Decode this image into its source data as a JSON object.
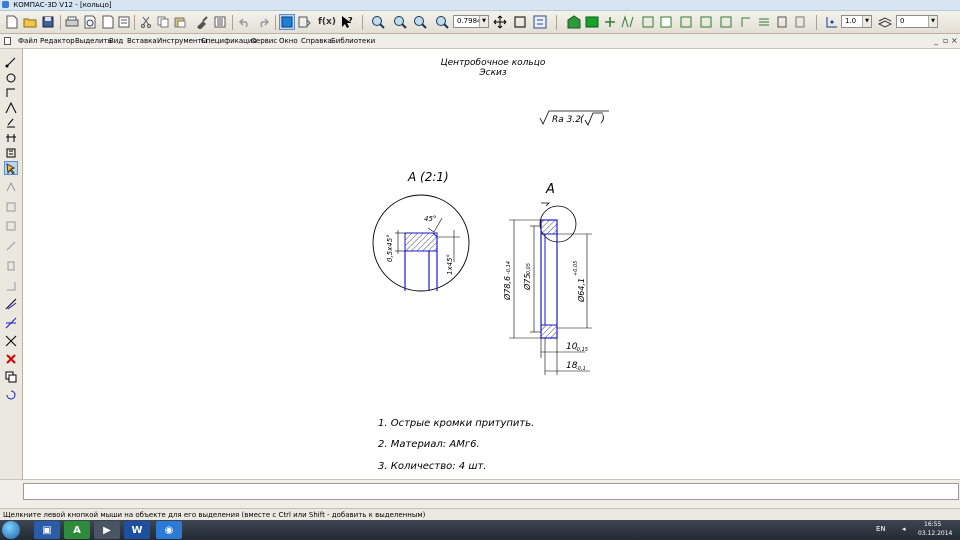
{
  "window": {
    "title": "КОМПАС-3D V12 - [кольцо]"
  },
  "toolbar": {
    "zoom_value": "0.7984",
    "line_scale": "1.0",
    "layer": "0",
    "fx_label": "f(x)"
  },
  "menu": {
    "items": [
      "Файл",
      "Редактор",
      "Выделить",
      "Вид",
      "Вставка",
      "Инструменты",
      "Спецификация",
      "Сервис",
      "Окно",
      "Справка",
      "Библиотеки"
    ]
  },
  "window_controls": {
    "minimize": "_",
    "restore": "▫",
    "close": "×"
  },
  "drawing": {
    "title_line1": "Центробочное кольцо",
    "title_line2": "Эскиз",
    "roughness": "Ra 3.2",
    "detail_label": "А (2:1)",
    "view_marker": "А",
    "dims": {
      "chamfer_angle": "45°",
      "chamfer_left": "0,5х45°",
      "chamfer_right": "1х45°",
      "d_outer": "Ø78,6",
      "d_outer_tol": "-0,14",
      "d_mid": "Ø75",
      "d_mid_tol": "-0,05",
      "d_inner": "Ø64,1",
      "d_inner_tol": "+0,05",
      "width_10": "10",
      "width_10_tol": "-0,15",
      "width_18": "18",
      "width_18_tol": "-0,1"
    },
    "notes": [
      "1. Острые кромки притупить.",
      "2. Материал: АМг6.",
      "3. Количество: 4 шт."
    ]
  },
  "status": {
    "hint": "Щелкните левой кнопкой мыши на объекте для его выделения (вместе с Ctrl или Shift - добавить к выделенным)"
  },
  "taskbar": {
    "lang": "EN",
    "time": "16:55",
    "date": "03.12.2014"
  }
}
